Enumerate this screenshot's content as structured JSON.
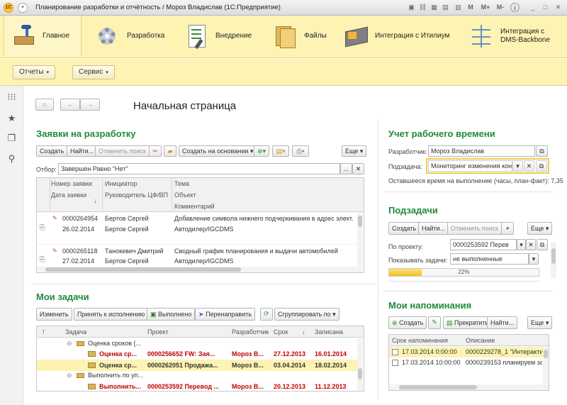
{
  "window": {
    "title": "Планирование разработки и отчётность / Мороз Владислав  (1С:Предприятие)",
    "tb_icons": [
      "M",
      "M+",
      "M-"
    ]
  },
  "ribbon": {
    "sections": [
      {
        "label": "Главное",
        "icon": "home-desk-icon"
      },
      {
        "label": "Разработка",
        "icon": "gears-icon"
      },
      {
        "label": "Внедрение",
        "icon": "checklist-icon"
      },
      {
        "label": "Файлы",
        "icon": "folders-icon"
      },
      {
        "label": "Интеграция с Итилиум",
        "icon": "integration-icon"
      },
      {
        "label": "Интеграция с DMS-Backbone",
        "icon": "network-icon"
      }
    ]
  },
  "subbar": {
    "reports": "Отчеты",
    "service": "Сервис"
  },
  "page": {
    "title": "Начальная страница"
  },
  "requests": {
    "title": "Заявки на разработку",
    "buttons": {
      "create": "Создать",
      "find": "Найти...",
      "cancel_search": "Отменить поиск",
      "create_based": "Создать на основании",
      "more": "Еще"
    },
    "filter_label": "Отбор:",
    "filter_value": "Завершен Равно \"Нет\"",
    "headers": {
      "num": "Номер заявки",
      "date": "Дата заявки",
      "initiator": "Инициатор",
      "head": "Руководитель ЦФ/ВП",
      "topic": "Тема",
      "object": "Объект",
      "comment": "Комментарий"
    },
    "rows": [
      {
        "num": "0000264954",
        "date": "26.02.2014",
        "initiator": "Бертов Сергей",
        "head": "Бертов Сергей",
        "topic": "Добавление символа нижнего подчеркивания в адрес элект...",
        "object": "Автодилер/IGCDMS"
      },
      {
        "num": "0000265118",
        "date": "27.02.2014",
        "initiator": "Танокевич Дмитрий",
        "head": "Бертов Сергей",
        "topic": "Сводный график планирования и выдачи автомобилей",
        "object": "Автодилер/IGCDMS"
      }
    ]
  },
  "tasks": {
    "title": "Мои задачи",
    "buttons": {
      "change": "Изменить",
      "accept": "Принять к исполнению",
      "done": "Выполнено",
      "redirect": "Перенаправить",
      "group": "Сгруппировать по"
    },
    "headers": {
      "flag": "!",
      "task": "Задача",
      "project": "Проект",
      "dev": "Разработчик",
      "term": "Срок",
      "recorded": "Записана"
    },
    "rows": [
      {
        "group": "Оценка сроков (..."
      },
      {
        "task": "Оценка ср...",
        "project": "0000256652 FW: Зая...",
        "dev": "Мороз В...",
        "term": "27.12.2013",
        "recorded": "16.01.2014",
        "style": "red"
      },
      {
        "task": "Оценка ср...",
        "project": "0000262051 Продажа...",
        "dev": "Мороз В...",
        "term": "03.04.2014",
        "recorded": "18.02.2014",
        "style": "bold"
      },
      {
        "group": "Выполнить по уп..."
      },
      {
        "task": "Выполнить...",
        "project": "0000253592 Перевод ...",
        "dev": "Мороз В...",
        "term": "20.12.2013",
        "recorded": "11.12.2013",
        "style": "red"
      }
    ]
  },
  "worktime": {
    "title": "Учет рабочего времени",
    "dev_label": "Разработчик:",
    "dev_value": "Мороз Владислав",
    "task_label": "Подзадача:",
    "task_value": "Мониторинг изменения конф",
    "remaining": "Оставшееся время на выполнение (часы, план-факт): 7,35"
  },
  "subtasks": {
    "title": "Подзадачи",
    "buttons": {
      "create": "Создать",
      "find": "Найти...",
      "cancel_search": "Отменить поиск",
      "more": "Еще"
    },
    "project_label": "По проекту:",
    "project_value": "0000253592 Перев",
    "show_label": "Показывать задачи:",
    "show_value": "не выполненные",
    "progress": 22,
    "progress_text": "22%"
  },
  "reminders": {
    "title": "Мои напоминания",
    "buttons": {
      "create": "Создать",
      "stop": "Прекратить",
      "find": "Найти...",
      "more": "Еще"
    },
    "headers": {
      "term": "Срок напоминания",
      "desc": "Описание"
    },
    "rows": [
      {
        "term": "17.03.2014 0:00:00",
        "desc": "0000229278_1 \"Интерактив"
      },
      {
        "term": "17.03.2014 10:00:00",
        "desc": "0000239153 планируем за"
      }
    ]
  },
  "colors": {
    "accent_green": "#1e8a3a",
    "ribbon": "#fdf3b2",
    "selection": "#fdf3b2",
    "red_text": "#c00000"
  }
}
